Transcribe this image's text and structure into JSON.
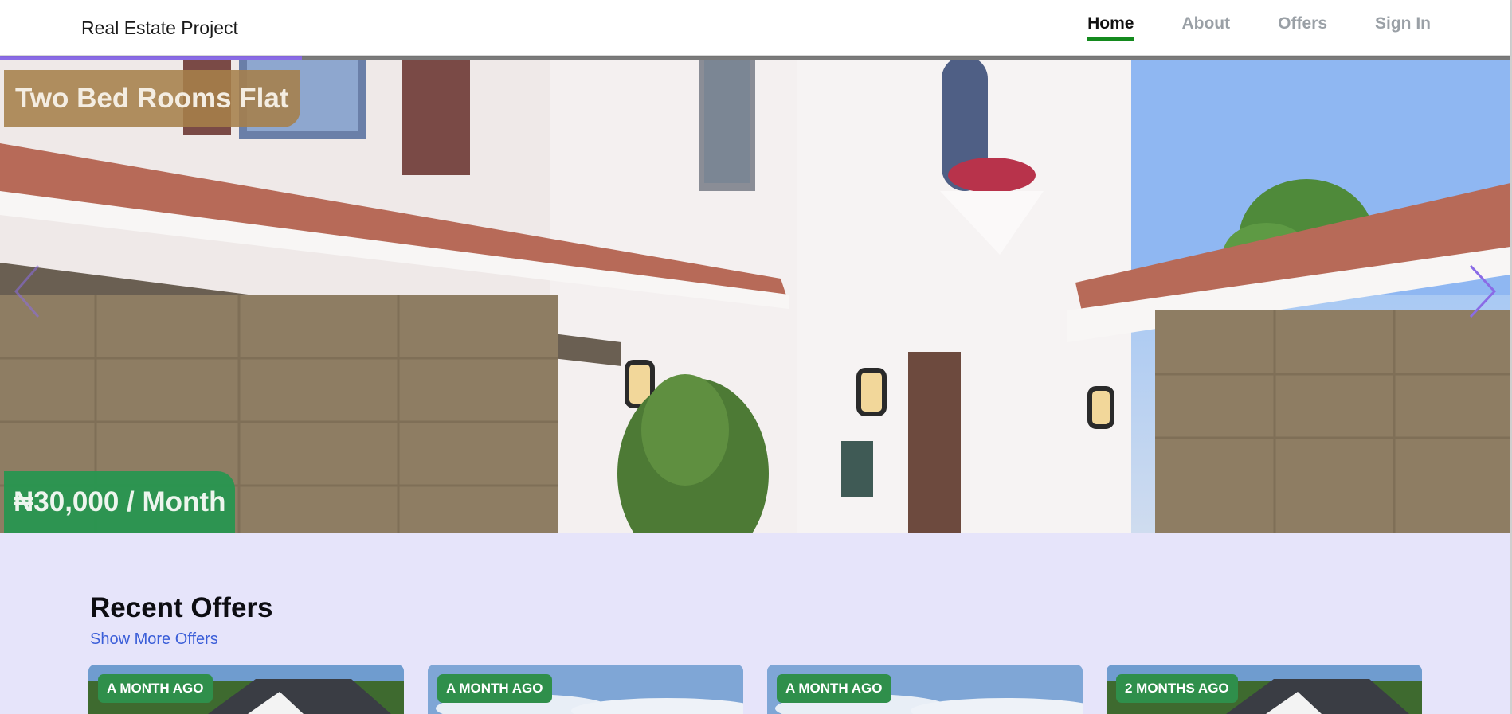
{
  "header": {
    "brand": "Real Estate Project",
    "nav": [
      {
        "label": "Home",
        "active": true
      },
      {
        "label": "About",
        "active": false
      },
      {
        "label": "Offers",
        "active": false
      },
      {
        "label": "Sign In",
        "active": false
      }
    ]
  },
  "hero": {
    "title": "Two Bed Rooms Flat",
    "price": "₦30,000 / Month",
    "slide_progress_percent": 20,
    "icons": {
      "prev": "chevron-left-icon",
      "next": "chevron-right-icon"
    }
  },
  "recent_offers": {
    "title": "Recent Offers",
    "show_more": "Show More Offers",
    "cards": [
      {
        "age": "A MONTH AGO"
      },
      {
        "age": "A MONTH AGO"
      },
      {
        "age": "A MONTH AGO"
      },
      {
        "age": "2 MONTHS AGO"
      }
    ]
  },
  "colors": {
    "accent_green": "#148a1e",
    "link_blue": "#3b5ed8",
    "progress_purple": "#8a6be6",
    "offers_bg": "#e6e4fa"
  }
}
